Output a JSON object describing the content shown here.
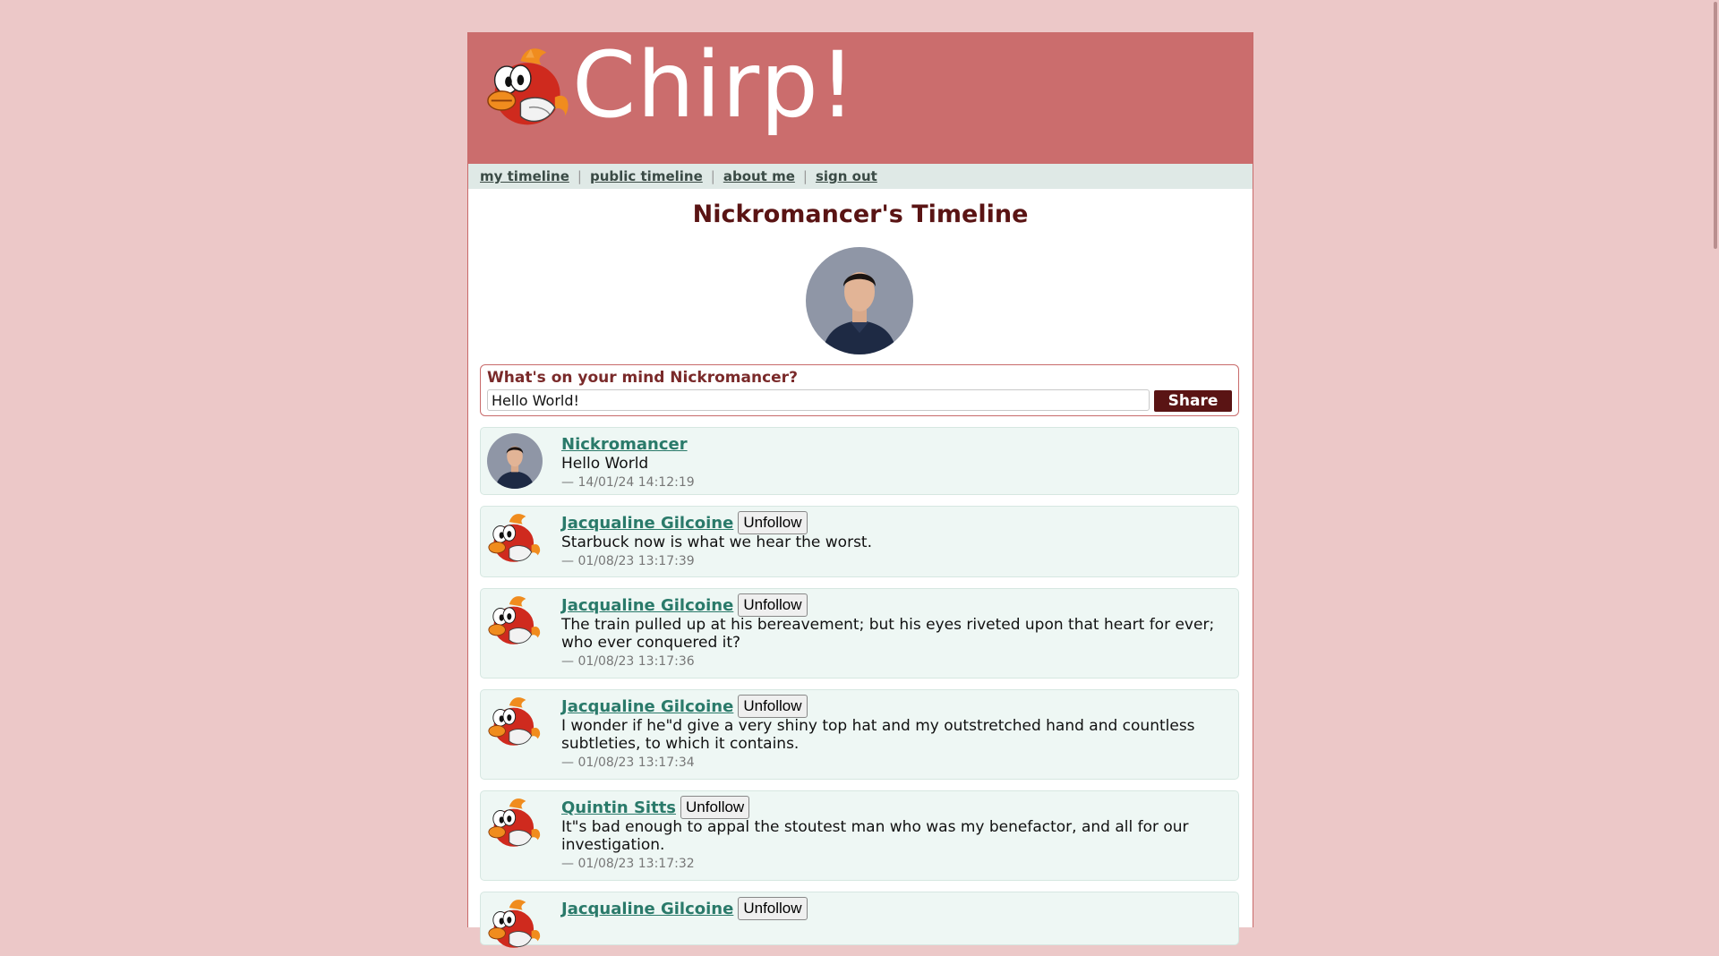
{
  "app": {
    "name": "Chirp!"
  },
  "nav": {
    "items": [
      "my timeline",
      "public timeline",
      "about me",
      "sign out"
    ]
  },
  "page_title": "Nickromancer's Timeline",
  "compose": {
    "label": "What's on your mind Nickromancer?",
    "value": "Hello World!",
    "share_label": "Share"
  },
  "posts": [
    {
      "author": "Nickromancer",
      "avatar": "person",
      "text": "Hello World",
      "time": "— 14/01/24 14:12:19",
      "unfollow": ""
    },
    {
      "author": "Jacqualine Gilcoine",
      "avatar": "bird",
      "text": "Starbuck now is what we hear the worst.",
      "time": "— 01/08/23 13:17:39",
      "unfollow": "Unfollow"
    },
    {
      "author": "Jacqualine Gilcoine",
      "avatar": "bird",
      "text": "The train pulled up at his bereavement; but his eyes riveted upon that heart for ever; who ever conquered it?",
      "time": "— 01/08/23 13:17:36",
      "unfollow": "Unfollow"
    },
    {
      "author": "Jacqualine Gilcoine",
      "avatar": "bird",
      "text": "I wonder if he\"d give a very shiny top hat and my outstretched hand and countless subtleties, to which it contains.",
      "time": "— 01/08/23 13:17:34",
      "unfollow": "Unfollow"
    },
    {
      "author": "Quintin Sitts",
      "avatar": "bird",
      "text": "It\"s bad enough to appal the stoutest man who was my benefactor, and all for our investigation.",
      "time": "— 01/08/23 13:17:32",
      "unfollow": "Unfollow"
    },
    {
      "author": "Jacqualine Gilcoine",
      "avatar": "bird",
      "text": "",
      "time": "",
      "unfollow": "Unfollow"
    }
  ],
  "colors": {
    "background": "#ecc8c8",
    "header": "#cb6d6d",
    "accent": "#5a1414",
    "link": "#2a7a6a",
    "post_bg": "#eef7f4"
  }
}
